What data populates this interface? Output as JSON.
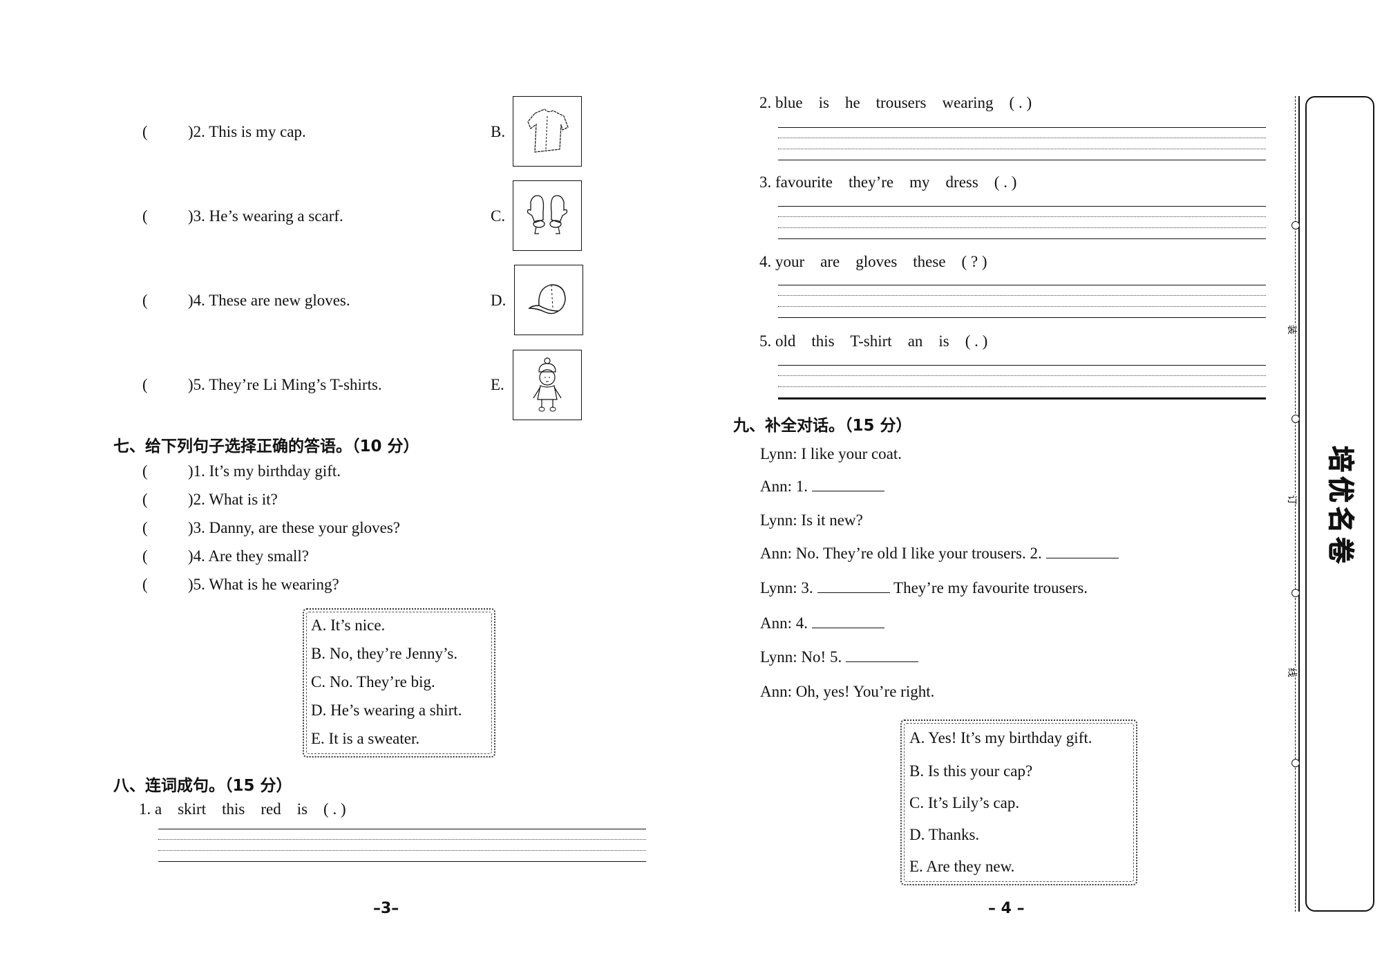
{
  "left_page": {
    "matching": {
      "items": [
        {
          "num": "2",
          "paren": "(",
          "close": ")",
          "text": "2. This is my cap."
        },
        {
          "num": "3",
          "paren": "(",
          "close": ")",
          "text": "3. He’s wearing a scarf."
        },
        {
          "num": "4",
          "paren": "(",
          "close": ")",
          "text": "4. These are new gloves."
        },
        {
          "num": "5",
          "paren": "(",
          "close": ")",
          "text": "5. They’re Li Ming’s T-shirts."
        }
      ],
      "pictures": [
        {
          "label": "B.",
          "icon": "t-shirt-picture"
        },
        {
          "label": "C.",
          "icon": "mittens-picture"
        },
        {
          "label": "D.",
          "icon": "cap-picture"
        },
        {
          "label": "E.",
          "icon": "child-in-winter-clothes-picture"
        }
      ]
    },
    "section7": {
      "title": "七、给下列句子选择正确的答语。（10 分）",
      "items": [
        {
          "paren": "(",
          "close": ")",
          "text": "1. It’s my birthday gift."
        },
        {
          "paren": "(",
          "close": ")",
          "text": "2. What is it?"
        },
        {
          "paren": "(",
          "close": ")",
          "text": "3. Danny, are these your gloves?"
        },
        {
          "paren": "(",
          "close": ")",
          "text": "4. Are they small?"
        },
        {
          "paren": "(",
          "close": ")",
          "text": "5. What is he wearing?"
        }
      ],
      "options": [
        "A. It’s nice.",
        "B. No, they’re Jenny’s.",
        "C. No. They’re big.",
        "D. He’s wearing a shirt.",
        "E. It is a sweater."
      ]
    },
    "section8": {
      "title": "八、连词成句。（15 分）",
      "items": [
        {
          "text": "1. a    skirt    this    red    is    ( . )"
        }
      ]
    },
    "page_number": "–3–"
  },
  "right_page": {
    "section8_cont": {
      "items": [
        {
          "text": "2. blue    is    he    trousers    wearing    ( . )"
        },
        {
          "text": "3. favourite    they’re    my    dress    ( . )"
        },
        {
          "text": "4. your    are    gloves    these    ( ? )"
        },
        {
          "text": "5. old    this    T-shirt    an    is    ( . )"
        }
      ]
    },
    "section9": {
      "title": "九、补全对话。（15 分）",
      "dialogue": [
        {
          "pre": "Lynn: I like your coat.",
          "blank": false,
          "post": ""
        },
        {
          "pre": "Ann: 1.",
          "blank": true,
          "post": ""
        },
        {
          "pre": "Lynn: Is it new?",
          "blank": false,
          "post": ""
        },
        {
          "pre": "Ann: No.  They’re old I like your trousers. 2.",
          "blank": true,
          "post": ""
        },
        {
          "pre": "Lynn: 3.",
          "blank": true,
          "post": "They’re my favourite trousers."
        },
        {
          "pre": "Ann: 4.",
          "blank": true,
          "post": ""
        },
        {
          "pre": "Lynn: No!  5.",
          "blank": true,
          "post": ""
        },
        {
          "pre": "Ann: Oh, yes!  You’re right.",
          "blank": false,
          "post": ""
        }
      ],
      "options": [
        "A. Yes!  It’s my birthday gift.",
        "B. Is this your cap?",
        "C. It’s Lily’s cap.",
        "D. Thanks.",
        "E. Are they new."
      ]
    },
    "page_number": "– 4 –"
  },
  "binding": {
    "labels": [
      "装",
      "订",
      "线"
    ],
    "logo": [
      "培",
      "优",
      "名",
      "卷"
    ]
  }
}
